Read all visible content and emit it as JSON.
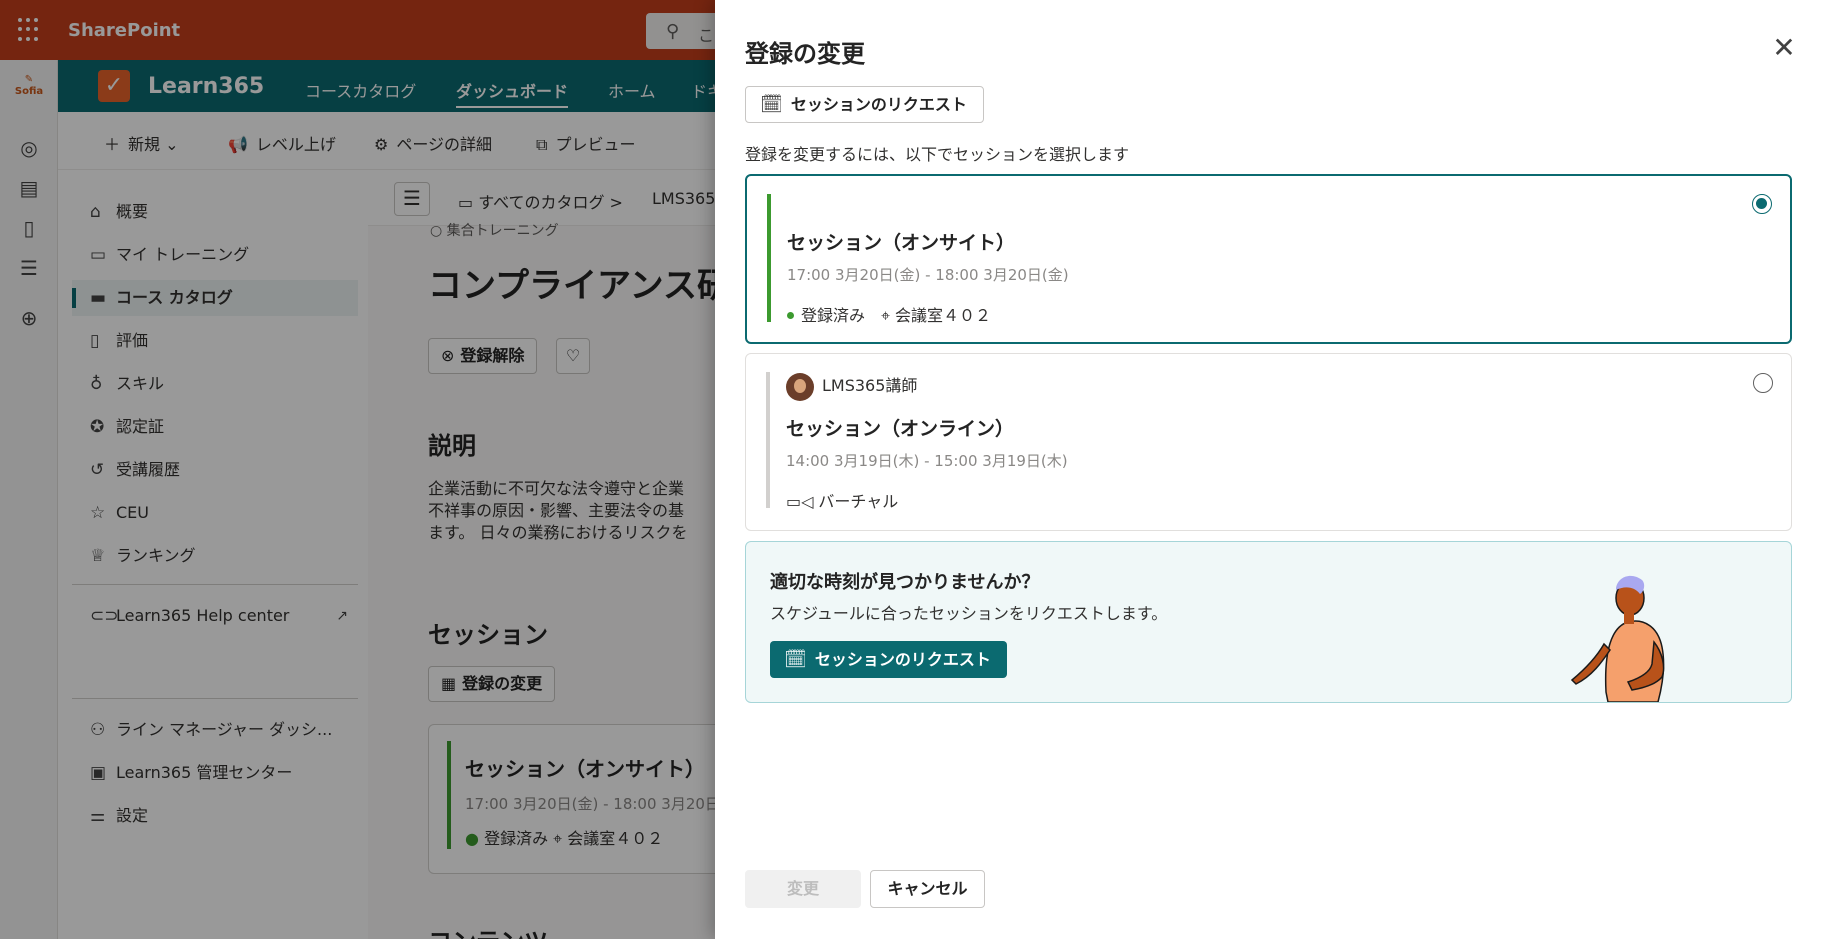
{
  "topbar": {
    "brand": "SharePoint",
    "search_placeholder": "こ"
  },
  "leftrail": {
    "logo_text": "Sofia"
  },
  "site": {
    "title": "Learn365",
    "nav": [
      "コースカタログ",
      "ダッシュボード",
      "ホーム",
      "ドキ"
    ],
    "active_nav": "ダッシュボード"
  },
  "commands": {
    "new": "新規",
    "promote": "レベル上げ",
    "page_details": "ページの詳細",
    "preview": "プレビュー"
  },
  "sidenav": {
    "items": [
      "概要",
      "マイ トレーニング",
      "コース カタログ",
      "評価",
      "スキル",
      "認定証",
      "受講履歴",
      "CEU",
      "ランキング"
    ],
    "help": "Learn365 Help center",
    "bottom": [
      "ライン マネージャー ダッシ...",
      "Learn365 管理センター",
      "設定"
    ]
  },
  "content": {
    "breadcrumb": [
      "すべてのカタログ",
      "LMS365"
    ],
    "type_label": "集合トレーニング",
    "title": "コンプライアンス研",
    "unregister": "登録解除",
    "description_heading": "説明",
    "description": "企業活動に不可欠な法令遵守と企業\n不祥事の原因・影響、主要法令の基\nます。 日々の業務におけるリスクを",
    "sessions_heading": "セッション",
    "change_registration": "登録の変更",
    "session_card": {
      "title": "セッション（オンサイト）",
      "date": "17:00 3月20日(金) - 18:00 3月20日",
      "status": "登録済み",
      "location": "会議室４０２"
    },
    "next_heading": "コンテンツ"
  },
  "panel": {
    "title": "登録の変更",
    "request_button": "セッションのリクエスト",
    "hint": "登録を変更するには、以下でセッションを選択します",
    "sessions": [
      {
        "title": "セッション（オンサイト）",
        "date": "17:00 3月20日(金) - 18:00 3月20日(金)",
        "status": "登録済み",
        "location": "会議室４０２",
        "selected": true
      },
      {
        "instructor": "LMS365講師",
        "title": "セッション（オンライン）",
        "date": "14:00 3月19日(木) - 15:00 3月19日(木)",
        "location": "バーチャル",
        "selected": false
      }
    ],
    "promo": {
      "title": "適切な時刻が見つかりませんか？",
      "subtitle": "スケジュールに合ったセッションをリクエストします。",
      "button": "セッションのリクエスト"
    },
    "footer": {
      "change": "変更",
      "cancel": "キャンセル"
    }
  },
  "colors": {
    "accent": "#0b6a70",
    "suite_bar": "#c43e1c",
    "registered": "#3c9a2f"
  }
}
